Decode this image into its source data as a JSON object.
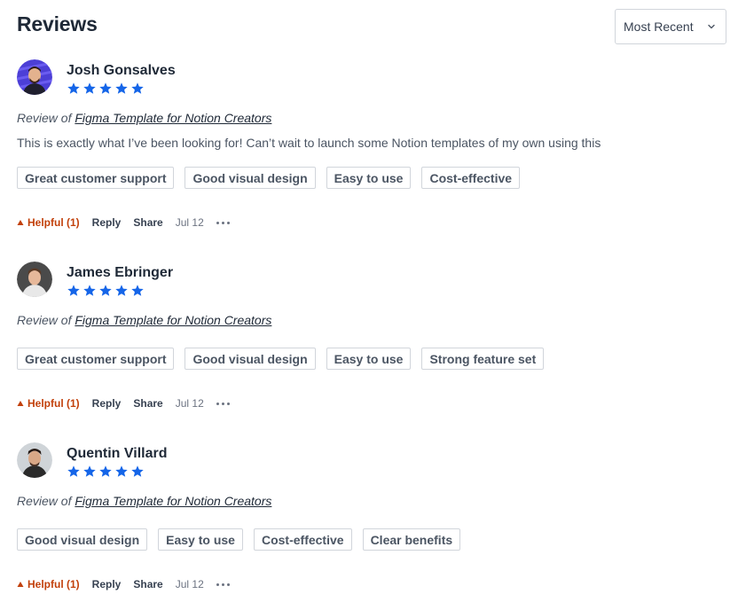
{
  "header": {
    "title": "Reviews",
    "sort_label": "Most Recent"
  },
  "colors": {
    "star": "#1565e8",
    "helpful": "#c2410c"
  },
  "reviews": [
    {
      "name": "Josh Gonsalves",
      "rating": 5,
      "review_of_prefix": "Review of",
      "product": "Figma Template for Notion Creators",
      "body": "This is exactly what I’ve been looking for! Can’t wait to launch some Notion templates of my own using this",
      "tags": [
        "Great customer support",
        "Good visual design",
        "Easy to use",
        "Cost-effective"
      ],
      "helpful": "Helpful (1)",
      "reply": "Reply",
      "share": "Share",
      "date": "Jul 12"
    },
    {
      "name": "James Ebringer",
      "rating": 5,
      "review_of_prefix": "Review of",
      "product": "Figma Template for Notion Creators",
      "body": "",
      "tags": [
        "Great customer support",
        "Good visual design",
        "Easy to use",
        "Strong feature set"
      ],
      "helpful": "Helpful (1)",
      "reply": "Reply",
      "share": "Share",
      "date": "Jul 12"
    },
    {
      "name": "Quentin Villard",
      "rating": 5,
      "review_of_prefix": "Review of",
      "product": "Figma Template for Notion Creators",
      "body": "",
      "tags": [
        "Good visual design",
        "Easy to use",
        "Cost-effective",
        "Clear benefits"
      ],
      "helpful": "Helpful (1)",
      "reply": "Reply",
      "share": "Share",
      "date": "Jul 12"
    }
  ]
}
